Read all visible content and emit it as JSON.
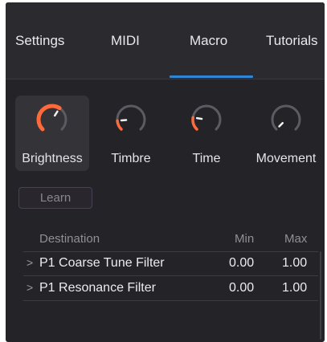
{
  "tabs": [
    {
      "label": "Settings"
    },
    {
      "label": "MIDI"
    },
    {
      "label": "Macro",
      "active": true
    },
    {
      "label": "Tutorials"
    }
  ],
  "colors": {
    "accent": "#2f85d6",
    "knob_active": "#ff6a3d",
    "knob_inactive": "#5b5b61",
    "background": "#242428"
  },
  "macros": [
    {
      "label": "Brightness",
      "level": 0.62,
      "selected": true
    },
    {
      "label": "Timbre",
      "level": 0.15
    },
    {
      "label": "Time",
      "level": 0.2
    },
    {
      "label": "Movement",
      "level": 0.0
    }
  ],
  "learn_button": {
    "label": "Learn"
  },
  "table": {
    "headers": {
      "destination": "Destination",
      "min": "Min",
      "max": "Max"
    },
    "rows": [
      {
        "destination": "P1 Coarse Tune Filter",
        "min": "0.00",
        "max": "1.00"
      },
      {
        "destination": "P1 Resonance Filter",
        "min": "0.00",
        "max": "1.00"
      }
    ]
  }
}
